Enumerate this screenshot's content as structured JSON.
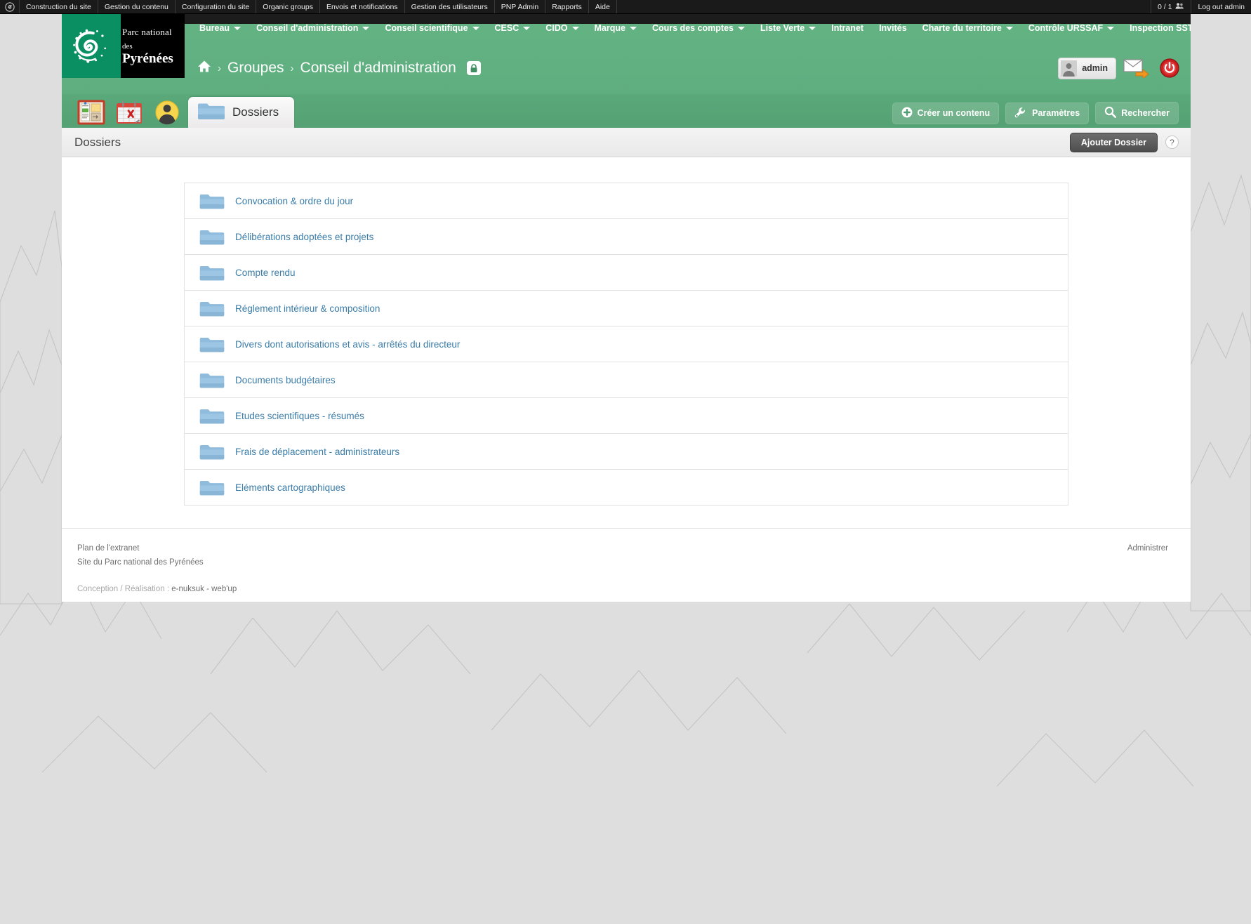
{
  "admin_toolbar": {
    "logo_icon": "spiral-logo-icon",
    "items": [
      "Construction du site",
      "Gestion du contenu",
      "Configuration du site",
      "Organic groups",
      "Envois et notifications",
      "Gestion des utilisateurs",
      "PNP Admin",
      "Rapports",
      "Aide"
    ],
    "user_count": "0 / 1",
    "users_icon": "users-icon",
    "logout": "Log out admin"
  },
  "logo": {
    "line1": "Parc national",
    "line2_small": "des",
    "line2": "Pyrénées",
    "mark_icon": "spiral-logo-icon"
  },
  "topnav": {
    "items": [
      {
        "label": "Bureau",
        "caret": true
      },
      {
        "label": "Conseil d'administration",
        "caret": true
      },
      {
        "label": "Conseil scientifique",
        "caret": true
      },
      {
        "label": "CESC",
        "caret": true
      },
      {
        "label": "CIDO",
        "caret": true
      },
      {
        "label": "Marque",
        "caret": true
      },
      {
        "label": "Cours des comptes",
        "caret": true
      },
      {
        "label": "Liste Verte",
        "caret": true
      },
      {
        "label": "Intranet",
        "caret": false
      },
      {
        "label": "Invités",
        "caret": false
      },
      {
        "label": "Charte du territoire",
        "caret": true
      },
      {
        "label": "Contrôle URSSAF",
        "caret": true
      },
      {
        "label": "Inspection SST",
        "caret": true
      }
    ]
  },
  "breadcrumb": {
    "home_icon": "home-icon",
    "items": [
      "Groupes",
      "Conseil d'administration"
    ],
    "separator": "›",
    "lock_icon": "lock-icon"
  },
  "user_area": {
    "avatar_icon": "user-avatar-icon",
    "username": "admin",
    "mail_icon": "mail-forward-icon",
    "power_icon": "power-off-icon"
  },
  "tabs": {
    "icons": [
      {
        "name": "bulletin-board-icon",
        "title": "Tableau de bord"
      },
      {
        "name": "calendar-icon",
        "title": "Agenda"
      },
      {
        "name": "member-icon",
        "title": "Membres"
      }
    ],
    "active": {
      "icon": "folder-icon",
      "label": "Dossiers"
    },
    "actions": [
      {
        "icon": "plus-circle-icon",
        "label": "Créer un contenu"
      },
      {
        "icon": "wrench-icon",
        "label": "Paramètres"
      },
      {
        "icon": "search-icon",
        "label": "Rechercher"
      }
    ]
  },
  "page": {
    "title": "Dossiers",
    "add_button": "Ajouter Dossier",
    "help_button": "?"
  },
  "folders": [
    "Convocation & ordre du jour",
    "Délibérations adoptées et projets",
    "Compte rendu",
    "Réglement intérieur & composition",
    "Divers dont autorisations et avis - arrêtés du directeur",
    "Documents budgétaires",
    "Etudes scientifiques - résumés",
    "Frais de déplacement - administrateurs",
    "Eléments cartographiques"
  ],
  "footer": {
    "links": [
      "Plan de l'extranet",
      "Site du Parc national des Pyrénées"
    ],
    "credits_prefix": "Conception / Réalisation : ",
    "credits_names": "e-nuksuk - web'up",
    "admin_link": "Administrer"
  },
  "colors": {
    "header_green": "#62b182",
    "tabstrip_green": "#57a476",
    "link_blue": "#3a7ca8",
    "toolbar_black": "#1a1a1a",
    "logo_teal": "#0a8f62"
  }
}
